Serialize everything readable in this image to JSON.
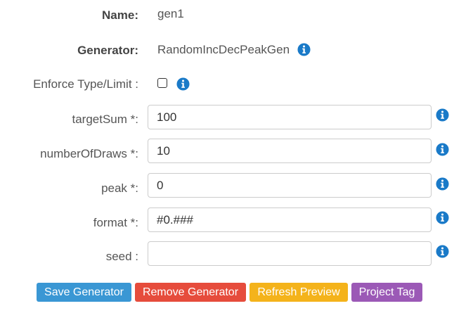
{
  "form": {
    "name_label": "Name:",
    "name_value": "gen1",
    "generator_label": "Generator:",
    "generator_value": "RandomIncDecPeakGen",
    "enforce_label": "Enforce Type/Limit :",
    "enforce_checked": false,
    "target_sum_label": "targetSum *:",
    "target_sum_value": "100",
    "number_of_draws_label": "numberOfDraws *:",
    "number_of_draws_value": "10",
    "peak_label": "peak *:",
    "peak_value": "0",
    "format_label": "format *:",
    "format_value": "#0.###",
    "seed_label": "seed :",
    "seed_value": ""
  },
  "buttons": {
    "save": "Save Generator",
    "remove": "Remove Generator",
    "refresh": "Refresh Preview",
    "project_tag": "Project Tag"
  },
  "colors": {
    "info_icon": "#1a7ac8",
    "save": "#3a97d4",
    "remove": "#e64c3c",
    "refresh": "#f4b31b",
    "project_tag": "#9b59b6"
  }
}
